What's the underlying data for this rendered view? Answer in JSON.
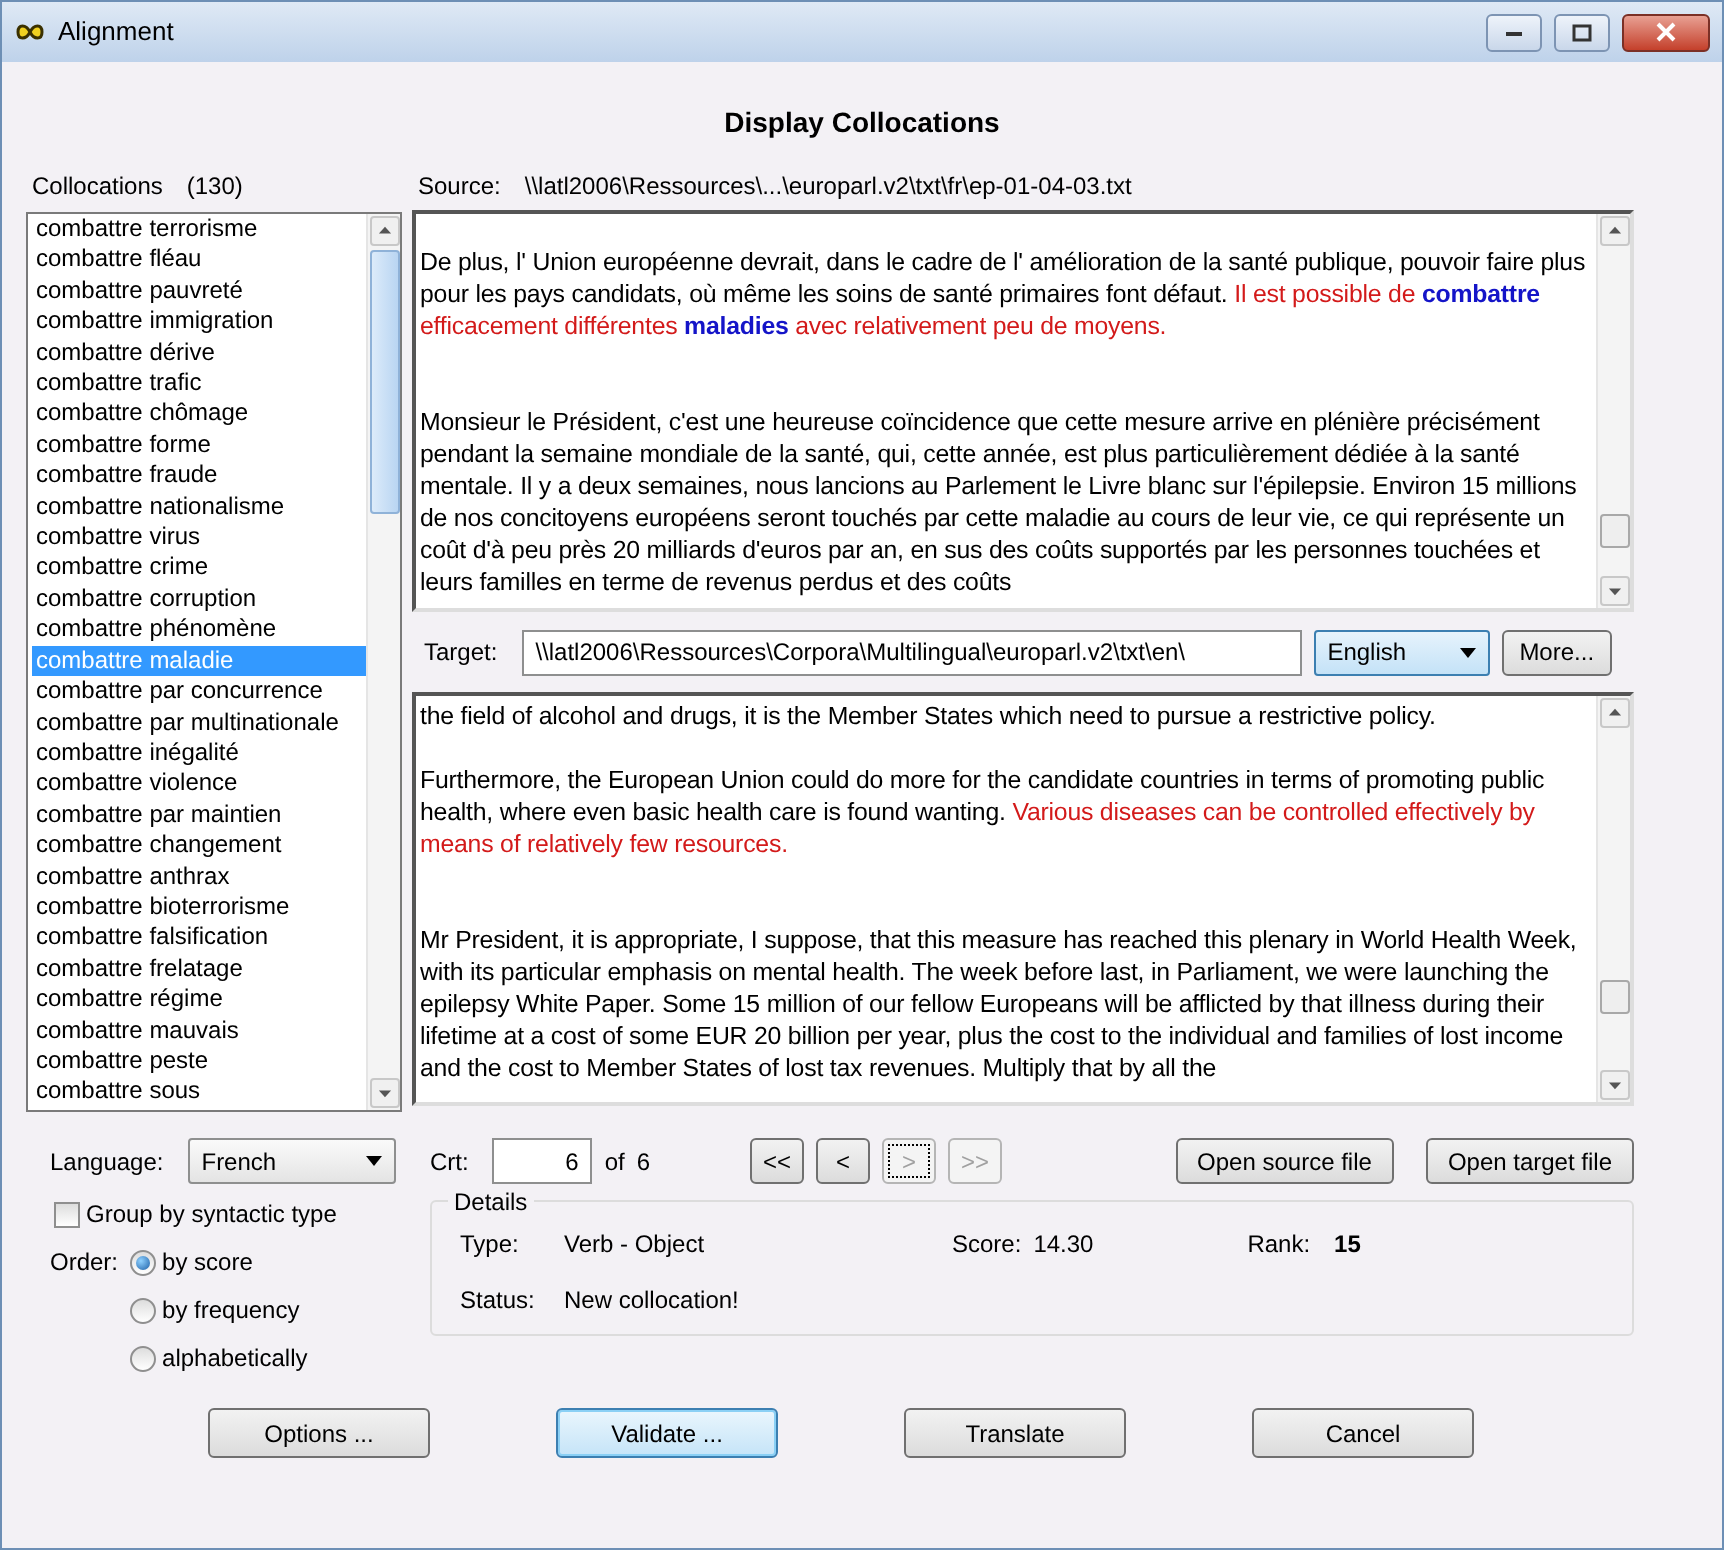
{
  "window": {
    "title": "Alignment"
  },
  "heading": "Display Collocations",
  "collocations": {
    "label": "Collocations",
    "count": "(130)",
    "items": [
      {
        "text": "combattre terrorisme",
        "selected": false
      },
      {
        "text": "combattre fléau",
        "selected": false
      },
      {
        "text": "combattre pauvreté",
        "selected": false
      },
      {
        "text": "combattre immigration",
        "selected": false
      },
      {
        "text": "combattre dérive",
        "selected": false
      },
      {
        "text": "combattre trafic",
        "selected": false
      },
      {
        "text": "combattre chômage",
        "selected": false
      },
      {
        "text": "combattre forme",
        "selected": false
      },
      {
        "text": "combattre fraude",
        "selected": false
      },
      {
        "text": "combattre nationalisme",
        "selected": false
      },
      {
        "text": "combattre virus",
        "selected": false
      },
      {
        "text": "combattre crime",
        "selected": false
      },
      {
        "text": "combattre corruption",
        "selected": false
      },
      {
        "text": "combattre phénomène",
        "selected": false
      },
      {
        "text": "combattre maladie",
        "selected": true
      },
      {
        "text": "combattre par concurrence",
        "selected": false
      },
      {
        "text": "combattre par multinationale",
        "selected": false
      },
      {
        "text": "combattre inégalité",
        "selected": false
      },
      {
        "text": "combattre violence",
        "selected": false
      },
      {
        "text": "combattre par maintien",
        "selected": false
      },
      {
        "text": "combattre changement",
        "selected": false
      },
      {
        "text": "combattre anthrax",
        "selected": false
      },
      {
        "text": "combattre bioterrorisme",
        "selected": false
      },
      {
        "text": "combattre falsification",
        "selected": false
      },
      {
        "text": "combattre frelatage",
        "selected": false
      },
      {
        "text": "combattre régime",
        "selected": false
      },
      {
        "text": "combattre mauvais",
        "selected": false
      },
      {
        "text": "combattre peste",
        "selected": false
      },
      {
        "text": "combattre sous",
        "selected": false
      }
    ]
  },
  "source": {
    "label": "Source:",
    "path": "\\\\latl2006\\Ressources\\...\\europarl.v2\\txt\\fr\\ep-01-04-03.txt",
    "paragraphs": [
      {
        "segments": [
          {
            "kind": "plain",
            "text": "De plus, l' Union européenne devrait, dans le cadre de l' amélioration de la santé publique, pouvoir faire plus pour les pays candidats, où même les soins de santé primaires font défaut. "
          },
          {
            "kind": "aligned",
            "text": "Il est possible de "
          },
          {
            "kind": "keyword",
            "text": "combattre"
          },
          {
            "kind": "aligned",
            "text": " efficacement différentes "
          },
          {
            "kind": "keyword",
            "text": "maladies"
          },
          {
            "kind": "aligned",
            "text": " avec relativement peu de moyens."
          }
        ]
      },
      {
        "segments": [
          {
            "kind": "plain",
            "text": "Monsieur le Président, c'est une heureuse coïncidence que cette mesure arrive en plénière précisément pendant la semaine mondiale de la santé, qui, cette année, est plus particulièrement dédiée à la santé mentale. Il y a deux semaines, nous lancions au Parlement le Livre blanc sur l'épilepsie. Environ 15 millions de nos concitoyens européens seront touchés par cette maladie au cours de leur vie, ce qui représente un coût d'à peu près 20 milliards d'euros par an, en sus des coûts supportés par les personnes touchées et leurs familles en terme de revenus perdus et des coûts"
          }
        ]
      }
    ]
  },
  "target": {
    "label": "Target:",
    "path": "\\\\latl2006\\Ressources\\Corpora\\Multilingual\\europarl.v2\\txt\\en\\",
    "language": "English",
    "more": "More...",
    "paragraphs": [
      {
        "segments": [
          {
            "kind": "plain",
            "text": "the field of alcohol and drugs, it is the Member States which need to pursue a restrictive policy."
          }
        ]
      },
      {
        "segments": [
          {
            "kind": "plain",
            "text": "Furthermore, the European Union could do more for the candidate countries in terms of promoting public health, where even basic health care is found wanting. "
          },
          {
            "kind": "aligned",
            "text": "Various diseases can be controlled effectively by means of relatively few resources."
          }
        ]
      },
      {
        "segments": [
          {
            "kind": "plain",
            "text": "Mr President, it is appropriate, I suppose, that this measure has reached this plenary in World Health Week, with its particular emphasis on mental health. The week before last, in Parliament, we were launching the epilepsy White Paper. Some 15 million of our fellow Europeans will be afflicted by that illness during their lifetime at a cost of some EUR 20 billion per year, plus the cost to the individual and families of lost income and the cost to Member States of lost tax revenues. Multiply that by all the"
          }
        ]
      }
    ]
  },
  "language": {
    "label": "Language:",
    "value": "French"
  },
  "group_by": {
    "label": "Group by syntactic type",
    "checked": false
  },
  "order": {
    "label": "Order:",
    "options": [
      {
        "label": "by score",
        "selected": true
      },
      {
        "label": "by frequency",
        "selected": false
      },
      {
        "label": "alphabetically",
        "selected": false
      }
    ]
  },
  "crt": {
    "label": "Crt:",
    "value": "6",
    "of": "of",
    "total": "6"
  },
  "nav_buttons": [
    {
      "label": "<<",
      "disabled": false,
      "focused": false
    },
    {
      "label": "<",
      "disabled": false,
      "focused": false
    },
    {
      "label": ">",
      "disabled": true,
      "focused": true
    },
    {
      "label": ">>",
      "disabled": true,
      "focused": false
    }
  ],
  "file_buttons": [
    "Open source file",
    "Open target file"
  ],
  "details": {
    "legend": "Details",
    "type_label": "Type:",
    "type": "Verb - Object",
    "score_label": "Score:",
    "score": "14.30",
    "rank_label": "Rank:",
    "rank": "15",
    "status_label": "Status:",
    "status": "New collocation!"
  },
  "buttons": [
    {
      "label": "Options ...",
      "default": false
    },
    {
      "label": "Validate ...",
      "default": true
    },
    {
      "label": "Translate",
      "default": false
    },
    {
      "label": "Cancel",
      "default": false
    }
  ]
}
